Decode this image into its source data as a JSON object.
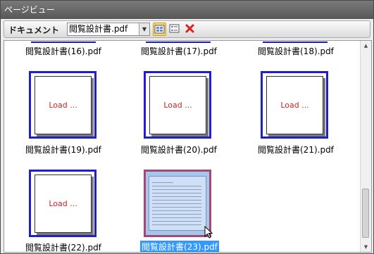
{
  "window": {
    "title": "ページビュー"
  },
  "toolbar": {
    "label": "ドキュメント",
    "document_select": "閲覧設計書.pdf",
    "buttons": [
      {
        "name": "grid-view",
        "icon": "grid-icon",
        "active": true
      },
      {
        "name": "list-view",
        "icon": "list-icon",
        "active": false
      },
      {
        "name": "close",
        "icon": "close-icon",
        "color": "#e0201a"
      }
    ]
  },
  "pages": {
    "top_row_captions": [
      "閲覧設計書(16).pdf",
      "閲覧設計書(17).pdf",
      "閲覧設計書(18).pdf"
    ],
    "row1": [
      {
        "caption": "閲覧設計書(19).pdf",
        "status": "Load ..."
      },
      {
        "caption": "閲覧設計書(20).pdf",
        "status": "Load ..."
      },
      {
        "caption": "閲覧設計書(21).pdf",
        "status": "Load ..."
      }
    ],
    "row2": [
      {
        "caption": "閲覧設計書(22).pdf",
        "status": "Load ..."
      },
      {
        "caption": "閲覧設計書(23).pdf",
        "status": "",
        "selected": true
      }
    ]
  },
  "colors": {
    "thumb_border": "#1f1fd0",
    "selected_border": "#a04a78",
    "load_text": "#d02020",
    "selection": "#3399ff"
  }
}
